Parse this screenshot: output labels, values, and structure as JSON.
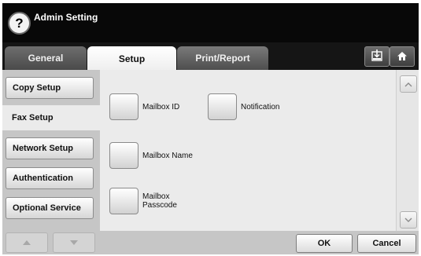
{
  "header": {
    "help_icon": "question-mark-icon",
    "help_glyph": "?",
    "title": "Admin Setting"
  },
  "tabs": [
    {
      "label": "General",
      "active": false
    },
    {
      "label": "Setup",
      "active": true
    },
    {
      "label": "Print/Report",
      "active": false
    }
  ],
  "toolbar": {
    "save_icon": "save-to-tray-icon",
    "home_icon": "home-icon"
  },
  "sidebar": {
    "items": [
      {
        "label": "Copy Setup",
        "active": false
      },
      {
        "label": "Fax Setup",
        "active": true
      },
      {
        "label": "Network Setup",
        "active": false
      },
      {
        "label": "Authentication",
        "active": false
      },
      {
        "label": "Optional Service",
        "active": false
      }
    ],
    "up_icon": "triangle-up-icon",
    "down_icon": "triangle-down-icon"
  },
  "options": [
    {
      "label": "Mailbox ID"
    },
    {
      "label": "Notification"
    },
    {
      "label": "Mailbox Name"
    },
    {
      "label_line1": "Mailbox",
      "label_line2": "Passcode"
    }
  ],
  "scroll": {
    "up_icon": "chevron-up-icon",
    "down_icon": "chevron-down-icon"
  },
  "actions": {
    "ok_label": "OK",
    "cancel_label": "Cancel"
  },
  "colors": {
    "title_bar": "#080808",
    "panel": "#ebebeb",
    "chrome": "#c8c8c8"
  }
}
